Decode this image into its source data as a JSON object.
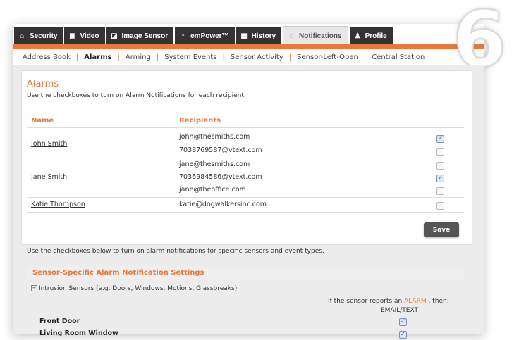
{
  "badge_number": "6",
  "tabs": [
    {
      "label": "Security",
      "icon": "home-icon",
      "active": false
    },
    {
      "label": "Video",
      "icon": "video-icon",
      "active": false
    },
    {
      "label": "Image Sensor",
      "icon": "image-sensor-icon",
      "active": false
    },
    {
      "label": "emPower™",
      "icon": "bulb-icon",
      "active": false
    },
    {
      "label": "History",
      "icon": "calendar-icon",
      "active": false
    },
    {
      "label": "Notifications",
      "icon": "speech-bubble-icon",
      "active": true
    },
    {
      "label": "Profile",
      "icon": "person-icon",
      "active": false
    }
  ],
  "subnav": [
    "Address Book",
    "Alarms",
    "Arming",
    "System Events",
    "Sensor Activity",
    "Sensor-Left-Open",
    "Central Station"
  ],
  "subnav_active": "Alarms",
  "alarms": {
    "title": "Alarms",
    "description": "Use the checkboxes to turn on Alarm Notifications for each recipient.",
    "col_name": "Name",
    "col_recipients": "Recipients",
    "save_label": "Save"
  },
  "recipients": [
    {
      "name": "John Smith",
      "emails": [
        {
          "address": "john@thesmiths.com",
          "checked": true
        },
        {
          "address": "7038769587@vtext.com",
          "checked": false
        }
      ]
    },
    {
      "name": "Jane Smith",
      "emails": [
        {
          "address": "jane@thesmiths.com",
          "checked": false
        },
        {
          "address": "7036984586@vtext.com",
          "checked": true
        },
        {
          "address": "jane@theoffice.com",
          "checked": false
        }
      ]
    },
    {
      "name": "Katie Thompson",
      "emails": [
        {
          "address": "katie@dogwalkersinc.com",
          "checked": false
        }
      ]
    }
  ],
  "sensor_section": {
    "description": "Use the checkboxes below to turn on alarm notifications for specific sensors and event types.",
    "title": "Sensor-Specific Alarm Notification Settings",
    "group_label": "Intrusion Sensors",
    "group_hint": " (e.g. Doors, Windows, Motions, Glassbreaks)",
    "report_prefix": "If the sensor reports an ",
    "report_alarm": "ALARM",
    "report_suffix": " , then:",
    "column": "EMAIL/TEXT",
    "sensors": [
      {
        "name": "Front Door",
        "checked": true
      },
      {
        "name": "Living Room Window",
        "checked": true
      }
    ]
  },
  "colors": {
    "accent": "#e8793a",
    "tab_dark": "#333333",
    "save_button": "#555555"
  }
}
